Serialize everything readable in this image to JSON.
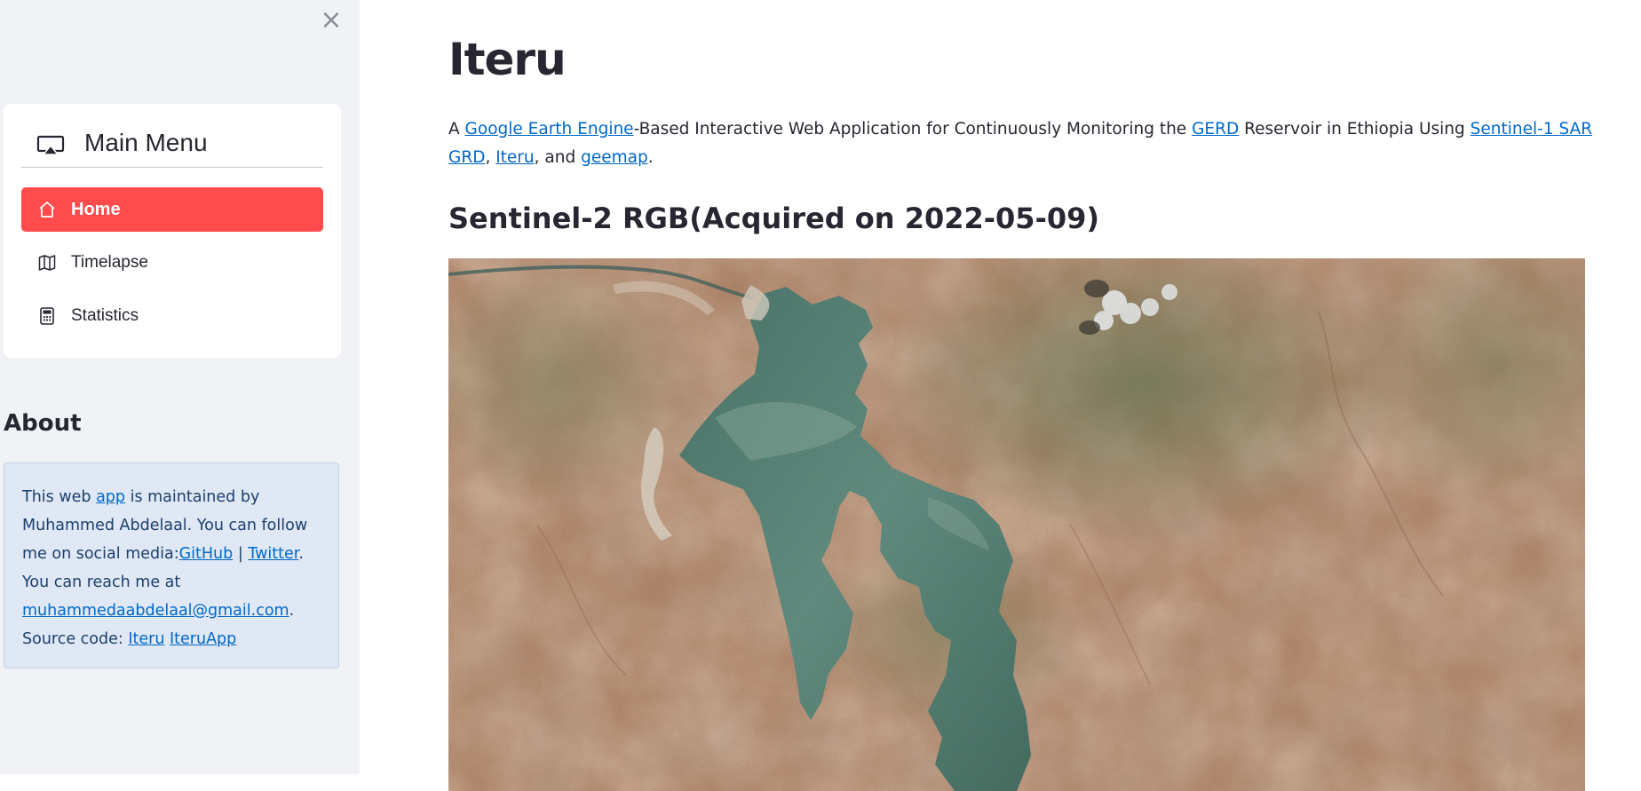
{
  "sidebar": {
    "close_icon": "close-icon",
    "menu": {
      "title": "Main Menu",
      "title_icon": "airplay-icon",
      "items": [
        {
          "label": "Home",
          "icon": "house-icon",
          "active": true
        },
        {
          "label": "Timelapse",
          "icon": "map-icon",
          "active": false
        },
        {
          "label": "Statistics",
          "icon": "calculator-icon",
          "active": false
        }
      ],
      "accent_color": "#ff4b4b"
    },
    "about": {
      "title": "About",
      "t1": "This web ",
      "link_app": "app",
      "t2": " is maintained by Muhammed Abdelaal. You can follow me on social media:",
      "link_github": "GitHub",
      "sep": " | ",
      "link_twitter": "Twitter",
      "t3": ". You can reach me at ",
      "link_email": "muhammedaabdelaal@gmail.com",
      "t4": ". Source code: ",
      "link_iteru": "Iteru",
      "t5": " ",
      "link_iteruapp": "IteruApp"
    }
  },
  "main": {
    "title": "Iteru",
    "intro": {
      "t1": "A ",
      "link_gee": "Google Earth Engine",
      "t2": "-Based Interactive Web Application for Continuously Monitoring the ",
      "link_gerd": "GERD",
      "t3": " Reservoir in Ethiopia Using ",
      "link_sentinel": "Sentinel-1 SAR GRD",
      "t4": ", ",
      "link_iteru": "Iteru",
      "t5": ", and ",
      "link_geemap": "geemap",
      "t6": "."
    },
    "subheading": "Sentinel-2 RGB(Acquired on 2022-05-09)",
    "image": {
      "land_color": "#b8896a",
      "water_color": "#5e8a7c",
      "vegetation_color": "#7f8a60"
    }
  }
}
